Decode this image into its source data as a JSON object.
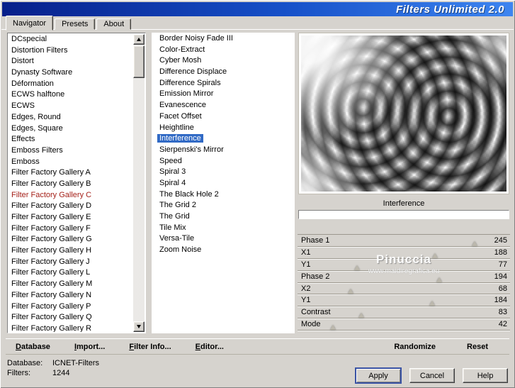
{
  "window": {
    "title": "Filters Unlimited 2.0"
  },
  "tabs": [
    "Navigator",
    "Presets",
    "About"
  ],
  "categories": {
    "selected": "Filter Factory Gallery C",
    "items": [
      "DCspecial",
      "Distortion Filters",
      "Distort",
      "Dynasty Software",
      "Déformation",
      "ECWS halftone",
      "ECWS",
      "Edges, Round",
      "Edges, Square",
      "Effects",
      "Emboss Filters",
      "Emboss",
      "Filter Factory Gallery A",
      "Filter Factory Gallery B",
      "Filter Factory Gallery C",
      "Filter Factory Gallery D",
      "Filter Factory Gallery E",
      "Filter Factory Gallery F",
      "Filter Factory Gallery G",
      "Filter Factory Gallery H",
      "Filter Factory Gallery J",
      "Filter Factory Gallery L",
      "Filter Factory Gallery M",
      "Filter Factory Gallery N",
      "Filter Factory Gallery P",
      "Filter Factory Gallery Q",
      "Filter Factory Gallery R"
    ]
  },
  "filters": {
    "selected": "Interference",
    "items": [
      "Border Noisy Fade III",
      "Color-Extract",
      "Cyber Mosh",
      "Difference Displace",
      "Difference Spirals",
      "Emission Mirror",
      "Evanescence",
      "Facet Offset",
      "Heightline",
      "Interference",
      "Sierpenski's Mirror",
      "Speed",
      "Spiral 3",
      "Spiral 4",
      "The Black Hole 2",
      "The Grid 2",
      "The Grid",
      "Tile Mix",
      "Versa-Tile",
      "Zoom Noise"
    ]
  },
  "preview": {
    "caption": "Interference"
  },
  "params": {
    "max": 255,
    "rows": [
      {
        "label": "Phase 1",
        "value": 245
      },
      {
        "label": "X1",
        "value": 188
      },
      {
        "label": "Y1",
        "value": 77
      },
      {
        "label": "Phase 2",
        "value": 194
      },
      {
        "label": "X2",
        "value": 68
      },
      {
        "label": "Y1",
        "value": 184
      },
      {
        "label": "Contrast",
        "value": 83
      },
      {
        "label": "Mode",
        "value": 42
      }
    ]
  },
  "watermark": {
    "line1": "Pinuccia",
    "line2": "www.maidiregrafica.eu"
  },
  "toolbar": {
    "left": [
      {
        "label": "Database",
        "u": 0
      },
      {
        "label": "Import...",
        "u": 0
      },
      {
        "label": "Filter Info...",
        "u": 0
      },
      {
        "label": "Editor...",
        "u": 0
      }
    ],
    "right": [
      {
        "label": "Randomize",
        "u": -1
      },
      {
        "label": "Reset",
        "u": -1
      }
    ]
  },
  "status": {
    "database_label": "Database:",
    "database_value": "ICNET-Filters",
    "filters_label": "Filters:",
    "filters_value": "1244"
  },
  "actions": [
    "Apply",
    "Cancel",
    "Help"
  ],
  "colors": {
    "dialog_bg": "#d6d3ce",
    "titlebar_start": "#071f8a",
    "titlebar_mid": "#1650c8",
    "titlebar_end": "#3d85f0",
    "selection_blue": "#316ac5",
    "selected_category": "#a52019"
  }
}
